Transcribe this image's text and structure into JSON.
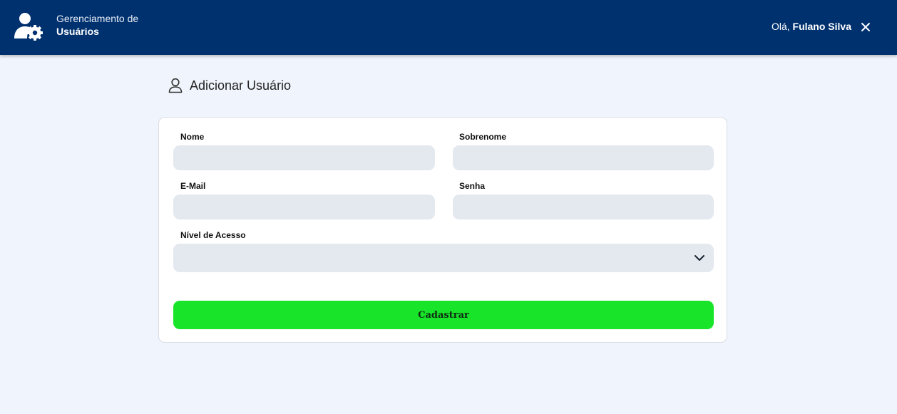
{
  "header": {
    "brand_line1": "Gerenciamento de",
    "brand_line2": "Usuários",
    "greeting": "Olá,",
    "user_name": "Fulano Silva",
    "brand_icon": "user-gear-icon",
    "close_icon": "close-icon"
  },
  "page": {
    "title": "Adicionar Usuário",
    "title_icon": "user-outline-icon"
  },
  "form": {
    "nome_label": "Nome",
    "nome_value": "",
    "sobrenome_label": "Sobrenome",
    "sobrenome_value": "",
    "email_label": "E-Mail",
    "email_value": "",
    "senha_label": "Senha",
    "senha_value": "",
    "nivel_label": "Nível de Acesso",
    "nivel_value": "",
    "submit_label": "Cadastrar"
  },
  "colors": {
    "header_bg": "#00316f",
    "page_bg": "#f0f4fc",
    "input_bg": "#e4e8ef",
    "submit_bg": "#18e52a"
  }
}
